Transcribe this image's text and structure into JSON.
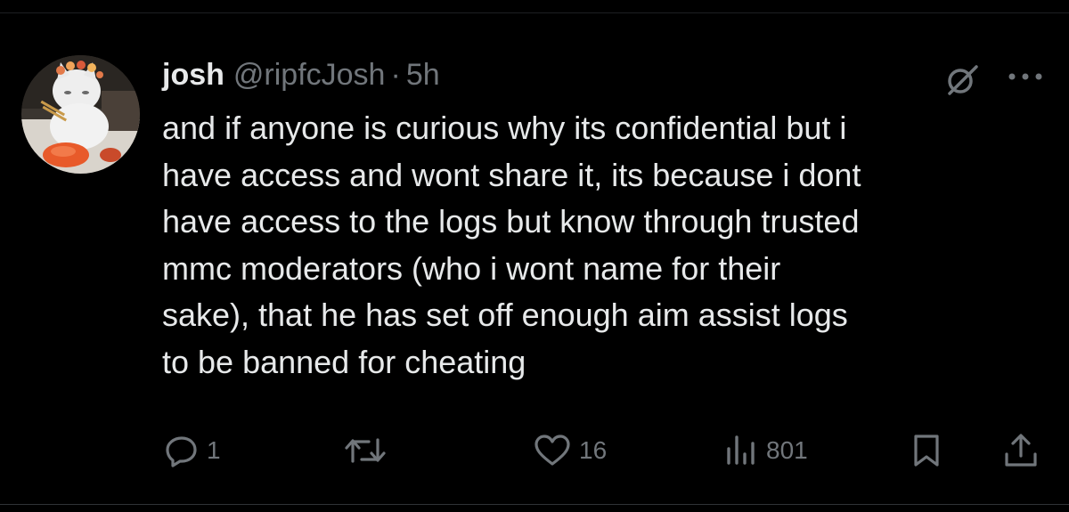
{
  "author": {
    "display_name": "josh",
    "handle": "@ripfcJosh",
    "separator": "·",
    "time": "5h",
    "avatar_icon": "white-cat-avatar"
  },
  "tweet": {
    "lines": [
      "and if anyone is curious why its confidential but i",
      "have access and wont share it, its because i dont",
      "have access to the logs but know through trusted",
      "mmc moderators (who i wont name for their",
      "sake), that he has set off enough aim assist logs",
      "to be banned for cheating"
    ]
  },
  "actions": {
    "reply": {
      "icon": "reply-icon",
      "count": "1"
    },
    "retweet": {
      "icon": "retweet-icon",
      "count": ""
    },
    "like": {
      "icon": "heart-icon",
      "count": "16"
    },
    "views": {
      "icon": "views-icon",
      "count": "801"
    },
    "bookmark": {
      "icon": "bookmark-icon"
    },
    "share": {
      "icon": "share-icon"
    }
  },
  "header_icons": {
    "grok": "grok-icon",
    "more": "more-icon"
  },
  "colors": {
    "background": "#000000",
    "text_primary": "#e7e9ea",
    "text_secondary": "#71767b"
  }
}
